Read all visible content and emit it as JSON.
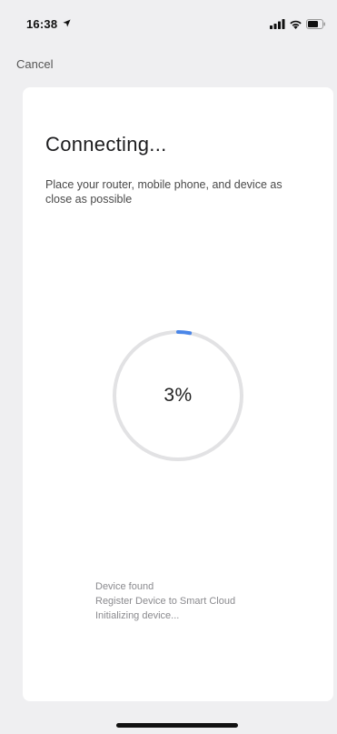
{
  "status_bar": {
    "time": "16:38",
    "location_icon": "location-arrow-icon",
    "signal_icon": "cellular-signal-icon",
    "wifi_icon": "wifi-icon",
    "battery_icon": "battery-icon"
  },
  "nav": {
    "cancel_label": "Cancel"
  },
  "card": {
    "title": "Connecting...",
    "subtitle": "Place your router, mobile phone, and device as close as possible",
    "progress": {
      "percent": 3,
      "label": "3%"
    },
    "steps": [
      "Device found",
      "Register Device to Smart Cloud",
      "Initializing device..."
    ]
  },
  "colors": {
    "background": "#efeff1",
    "card": "#ffffff",
    "ring_track": "#e2e2e4",
    "ring_progress": "#4a86e8",
    "step_text": "#8a8a8e"
  }
}
